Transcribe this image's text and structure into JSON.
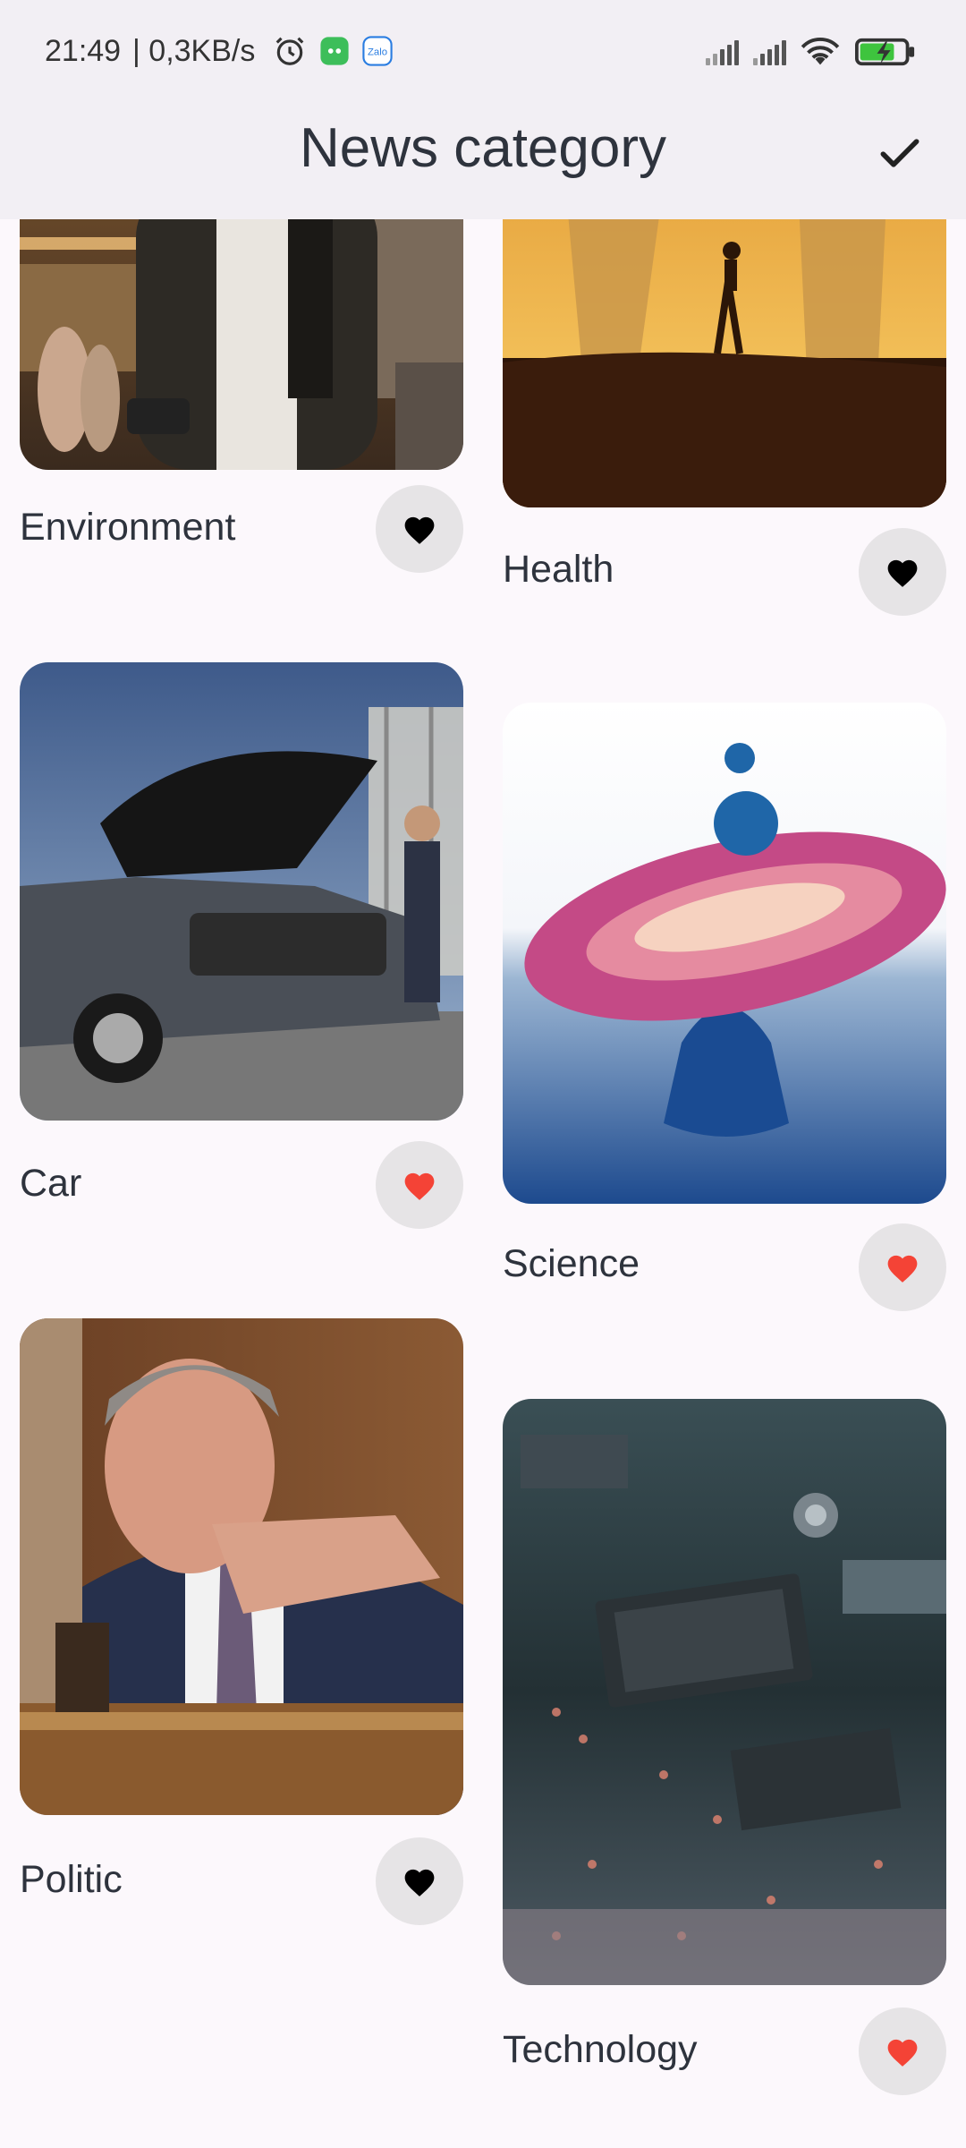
{
  "status_bar": {
    "time": "21:49",
    "network_speed": "| 0,3KB/s",
    "icons": [
      "alarm-icon",
      "cat-app-icon",
      "zalo-pay-icon",
      "signal-icon",
      "signal-icon",
      "wifi-icon",
      "battery-charging-icon"
    ],
    "zalo_icon_text": "Zalo",
    "cat_icon_color": "#3dbe5a",
    "battery_color": "#3ec43e"
  },
  "app_bar": {
    "title": "News category",
    "confirm_icon": "check-icon"
  },
  "colors": {
    "background": "#fcf8fc",
    "topbar": "#f2eff4",
    "favorite_active": "#f44336",
    "favorite_inactive": "#000000",
    "favorite_button_bg": "#e6e4e6"
  },
  "categories": [
    {
      "label": "Environment",
      "favorite": false,
      "image": "man-in-jacket-city-photo"
    },
    {
      "label": "Health",
      "favorite": false,
      "image": "runner-silhouette-sunset-photo"
    },
    {
      "label": "Car",
      "favorite": true,
      "image": "hydrogen-suv-photo"
    },
    {
      "label": "Science",
      "favorite": true,
      "image": "water-splash-drop-photo"
    },
    {
      "label": "Politic",
      "favorite": false,
      "image": "senator-speaking-photo"
    },
    {
      "label": "Technology",
      "favorite": true,
      "image": "circuit-board-photo"
    }
  ]
}
